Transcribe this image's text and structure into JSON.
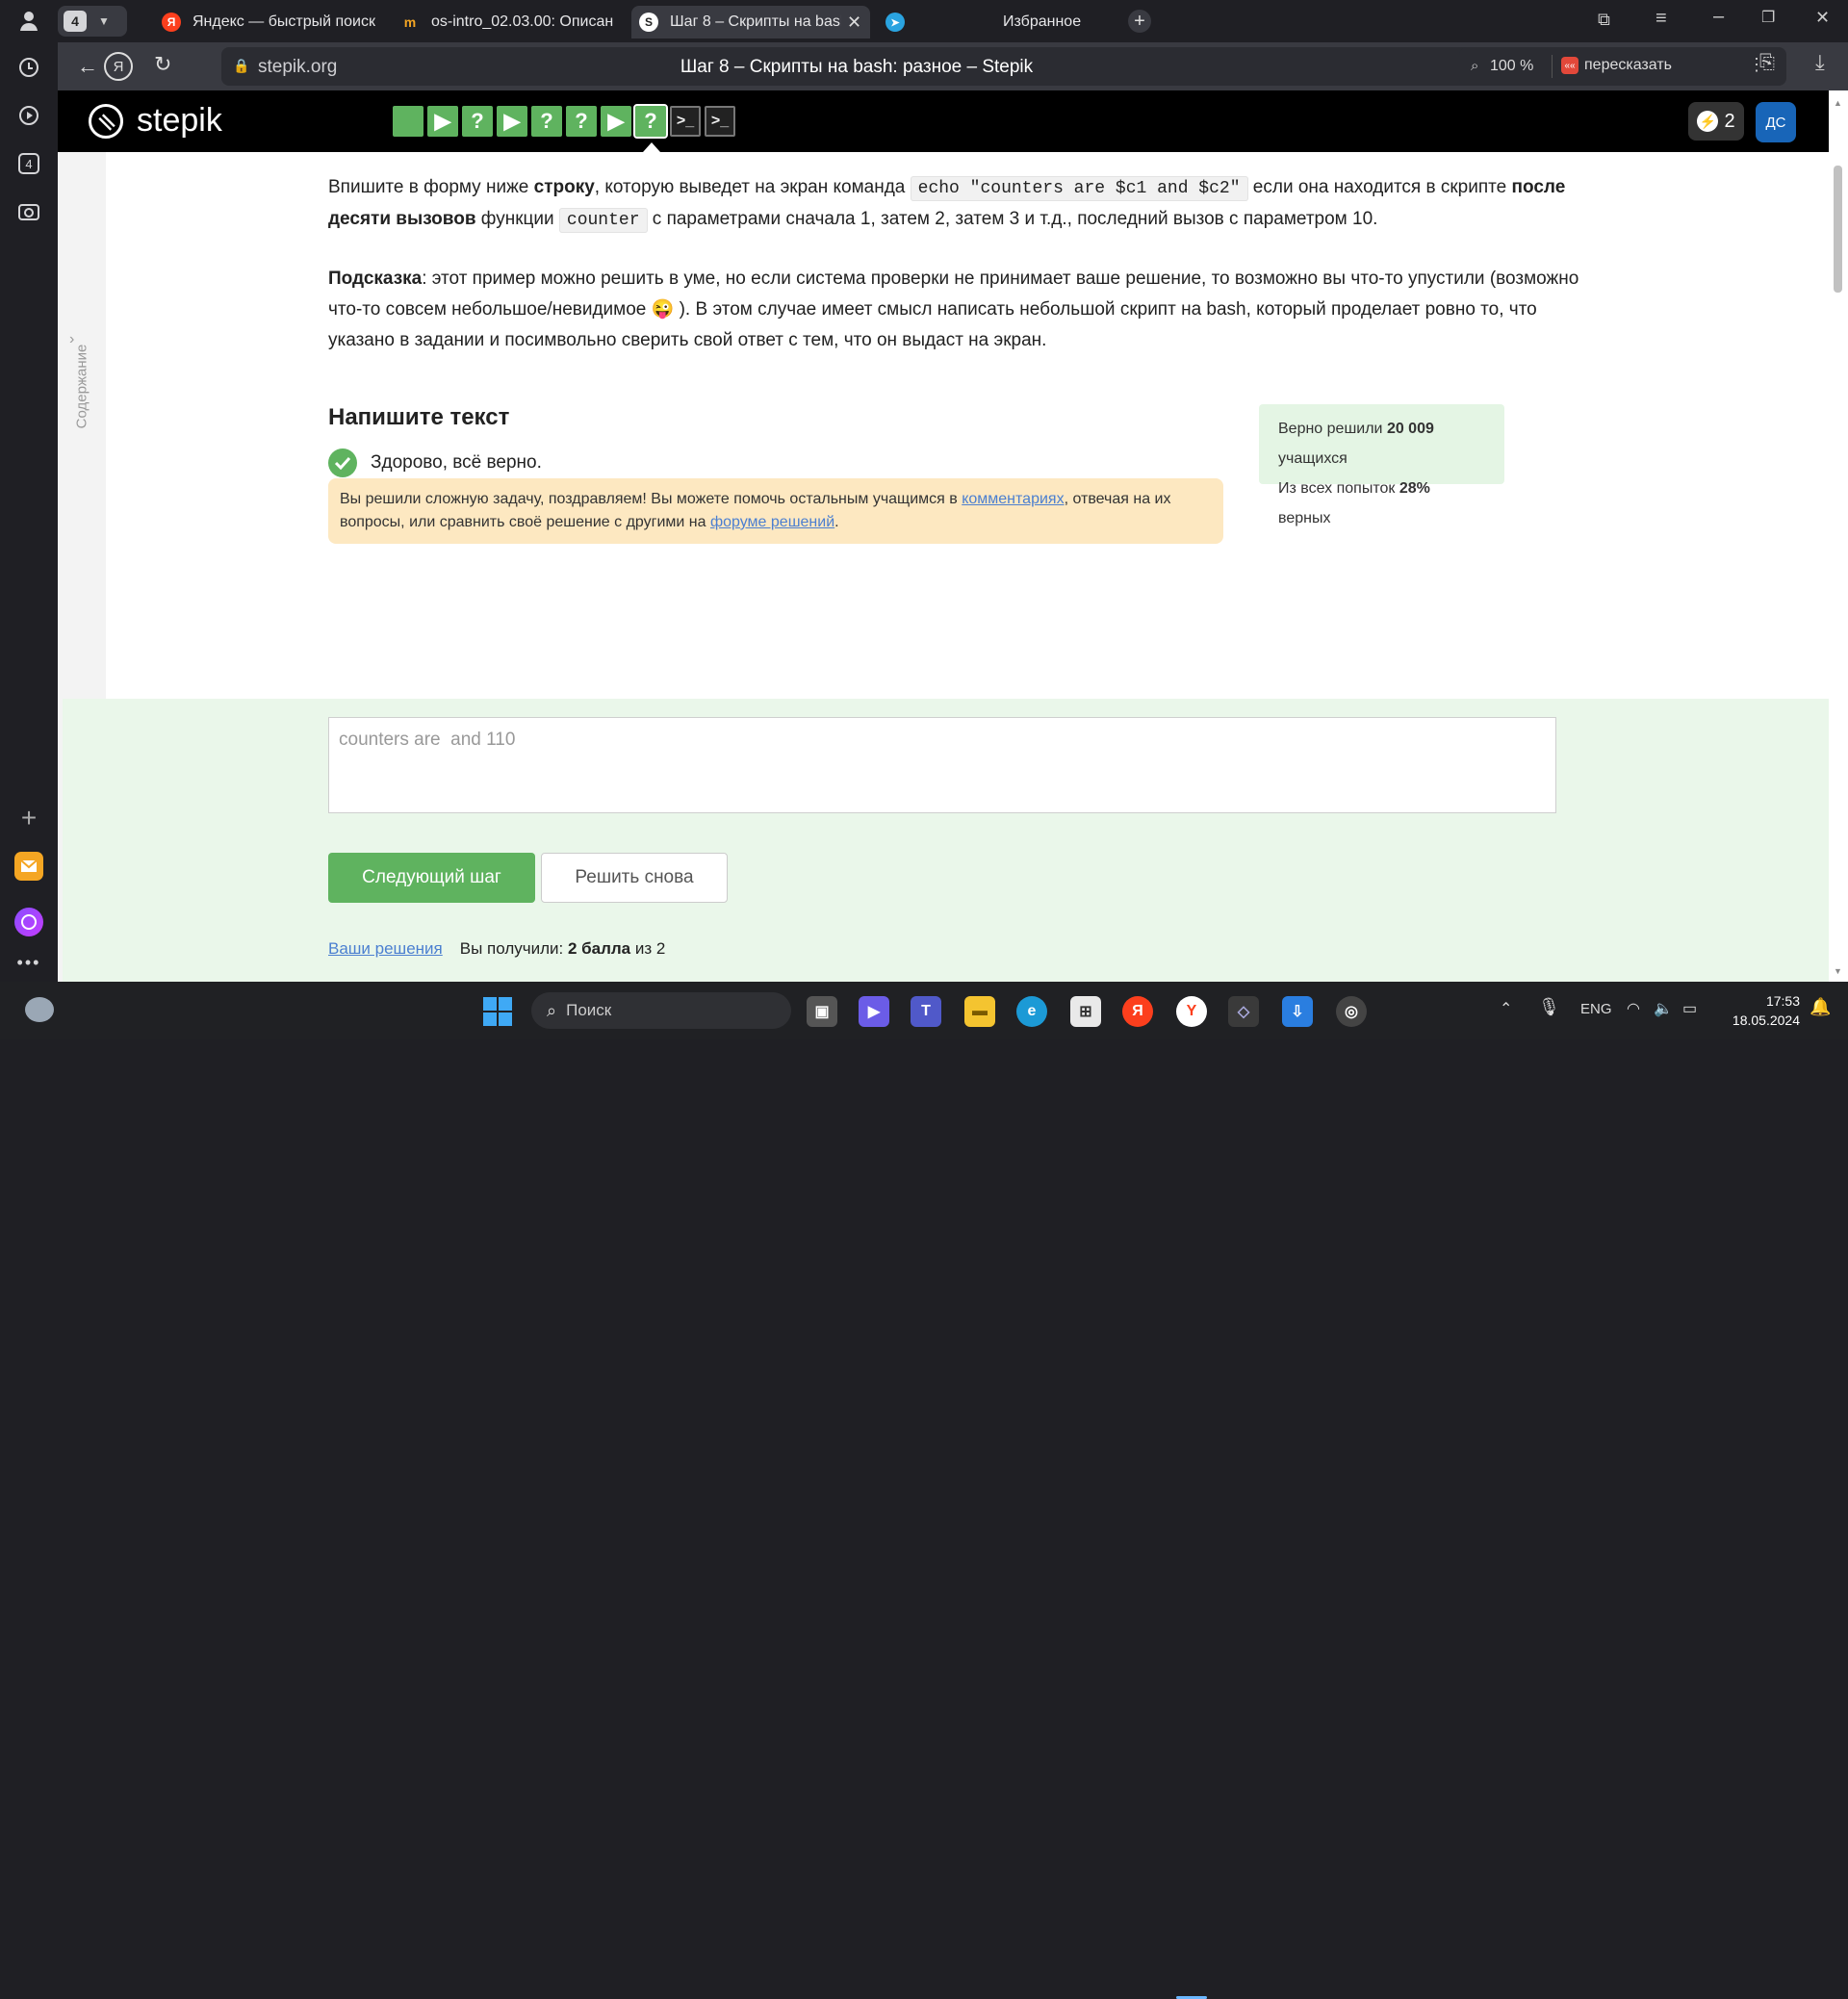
{
  "browser": {
    "tab_count": "4",
    "tabs": [
      {
        "title": "Яндекс — быстрый поиск",
        "icon": "yandex-icon"
      },
      {
        "title": "os-intro_02.03.00: Описан",
        "icon": "hexlet-icon"
      },
      {
        "title": "Шаг 8 – Скрипты на bash",
        "icon": "stepik-icon"
      },
      {
        "title": "",
        "icon": "telegram-icon"
      },
      {
        "title": "Избранное",
        "icon": ""
      }
    ],
    "url": "stepik.org",
    "page_title": "Шаг 8 – Скрипты на bash: разное – Stepik",
    "zoom": "100 %",
    "retell": "пересказать",
    "sidebar_badge": "4"
  },
  "stepik": {
    "logo": "stepik",
    "steps": [
      "",
      "▶",
      "?",
      "▶",
      "?",
      "?",
      "▶",
      "?",
      ">_",
      ">_"
    ],
    "energy": "2",
    "avatar": "ДС",
    "toc_label": "Содержание"
  },
  "task": {
    "p1_a": "Впишите в форму ниже ",
    "p1_b": "строку",
    "p1_c": ", которую выведет на экран команда ",
    "p1_code1": "echo \"counters are $c1 and $c2\"",
    "p1_d": " если она находится в скрипте ",
    "p1_e": "после десяти вызовов",
    "p1_f": " функции ",
    "p1_code2": "counter",
    "p1_g": " с параметрами сначала 1, затем 2, затем 3 и т.д., последний вызов с параметром 10.",
    "p2_a": "Подсказка",
    "p2_b": ": этот пример можно решить в уме, но если система проверки не принимает ваше решение, то возможно вы что-то упустили (возможно что-то совсем небольшое/невидимое ",
    "p2_emoji": "😜",
    "p2_c": " ). В этом случае имеет смысл написать небольшой скрипт на bash, который проделает ровно то, что указано в задании и посимвольно сверить свой ответ с тем, что он выдаст на экран."
  },
  "answer": {
    "heading": "Напишите текст",
    "status": "Здорово, всё верно.",
    "congrats_a": "Вы решили сложную задачу, поздравляем! Вы можете помочь остальным учащимся в ",
    "congrats_link1": "комментариях",
    "congrats_b": ", отвечая на их вопросы, или сравнить своё решение с другими на ",
    "congrats_link2": "форуме решений",
    "congrats_c": ".",
    "stats_a1": "Верно решили ",
    "stats_a2": "20 009",
    "stats_a3": " учащихся",
    "stats_b1": "Из всех попыток ",
    "stats_b2": "28%",
    "stats_b3": " верных",
    "input_value": "counters are  and 110",
    "next_button": "Следующий шаг",
    "retry_button": "Решить снова",
    "your_solutions": "Ваши решения",
    "score_a": "Вы получили: ",
    "score_b": "2 балла",
    "score_c": " из 2"
  },
  "taskbar": {
    "search": "Поиск",
    "lang": "ENG",
    "time": "17:53",
    "date": "18.05.2024"
  }
}
